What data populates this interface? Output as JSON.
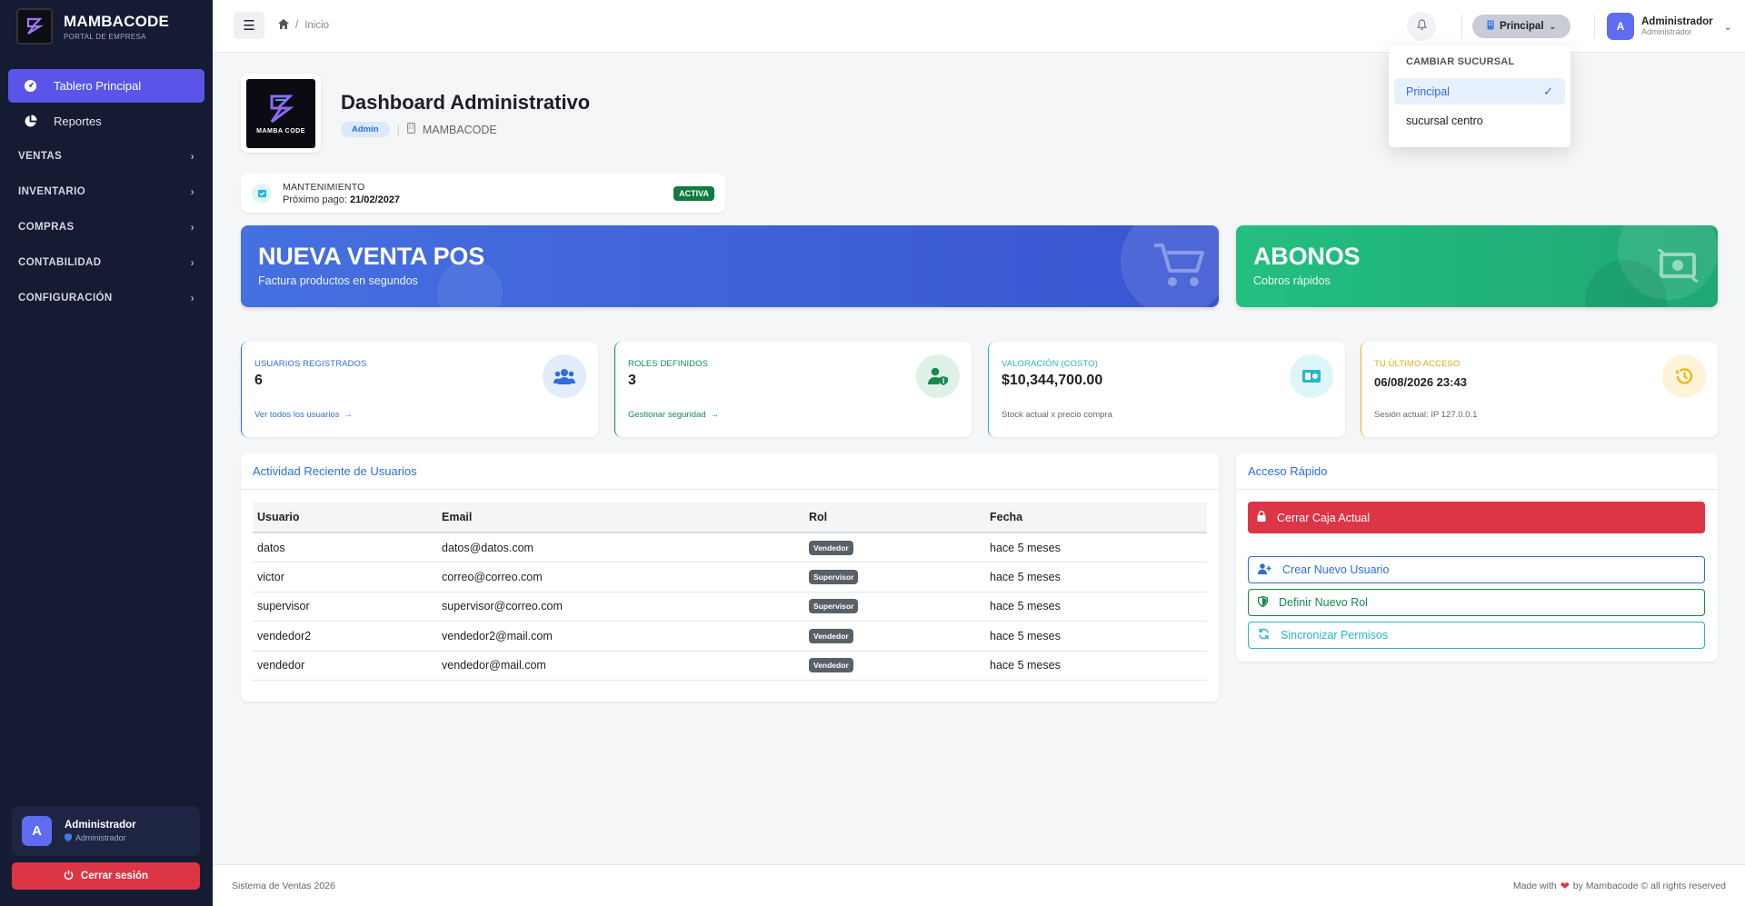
{
  "colors": {
    "sidebar_bg": "#141b33",
    "accent": "#5a55e8",
    "danger": "#dc3546",
    "success": "#0f7b3f",
    "link": "#2f6fd8",
    "promo_pos": "#4166dc",
    "promo_abonos": "#20b77a"
  },
  "sidebar": {
    "brand_name": "MAMBACODE",
    "brand_sub": "PORTAL DE EMPRESA",
    "items": [
      {
        "label": "Tablero Principal",
        "icon": "dashboard-icon"
      },
      {
        "label": "Reportes",
        "icon": "pie-chart-icon"
      }
    ],
    "groups": [
      "VENTAS",
      "INVENTARIO",
      "COMPRAS",
      "CONTABILIDAD",
      "CONFIGURACIÓN"
    ],
    "user": {
      "avatar": "A",
      "name": "Administrador",
      "role": "Administrador"
    },
    "logout_label": "Cerrar sesión"
  },
  "topbar": {
    "breadcrumb": {
      "separator": "/",
      "current": "Inicio"
    },
    "branch_label": "Principal",
    "user": {
      "avatar": "A",
      "name": "Administrador",
      "role": "Administrador"
    }
  },
  "branch_dropdown": {
    "title": "CAMBIAR SUCURSAL",
    "options": [
      {
        "label": "Principal",
        "selected": true
      },
      {
        "label": "sucursal centro",
        "selected": false
      }
    ]
  },
  "header": {
    "logo_text": "MAMBA CODE",
    "title": "Dashboard Administrativo",
    "role_badge": "Admin",
    "company": "MAMBACODE"
  },
  "maintenance": {
    "label": "MANTENIMIENTO",
    "next_payment_label": "Próximo pago:",
    "next_payment_date": "21/02/2027",
    "status": "ACTIVA"
  },
  "promos": [
    {
      "title": "NUEVA VENTA POS",
      "subtitle": "Factura productos en segundos",
      "icon": "cart-icon"
    },
    {
      "title": "ABONOS",
      "subtitle": "Cobros rápidos",
      "icon": "money-icon"
    }
  ],
  "stats": [
    {
      "label": "USUARIOS REGISTRADOS",
      "value": "6",
      "foot": "Ver todos los usuarios",
      "color": "#2f6fd8",
      "icon": "users-icon"
    },
    {
      "label": "ROLES DEFINIDOS",
      "value": "3",
      "foot": "Gestionar seguridad",
      "color": "#168a4e",
      "icon": "user-shield-icon"
    },
    {
      "label": "VALORACIÓN (COSTO)",
      "value": "$10,344,700.00",
      "foot": "Stock actual x precio compra",
      "color": "#27b6cf",
      "icon": "cash-register-icon"
    },
    {
      "label": "TU ÚLTIMO ACCESO",
      "value": "06/08/2026 23:43",
      "foot": "Sesión actual: IP 127.0.0.1",
      "color": "#f0b81c",
      "icon": "history-icon"
    }
  ],
  "activity": {
    "title": "Actividad Reciente de Usuarios",
    "columns": [
      "Usuario",
      "Email",
      "Rol",
      "Fecha"
    ],
    "rows": [
      {
        "user": "datos",
        "email": "datos@datos.com",
        "role": "Vendedor",
        "date": "hace 5 meses"
      },
      {
        "user": "victor",
        "email": "correo@correo.com",
        "role": "Supervisor",
        "date": "hace 5 meses"
      },
      {
        "user": "supervisor",
        "email": "supervisor@correo.com",
        "role": "Supervisor",
        "date": "hace 5 meses"
      },
      {
        "user": "vendedor2",
        "email": "vendedor2@mail.com",
        "role": "Vendedor",
        "date": "hace 5 meses"
      },
      {
        "user": "vendedor",
        "email": "vendedor@mail.com",
        "role": "Vendedor",
        "date": "hace 5 meses"
      }
    ]
  },
  "quick_access": {
    "title": "Acceso Rápido",
    "close_cash": "Cerrar Caja Actual",
    "new_user": "Crear Nuevo Usuario",
    "new_role": "Definir Nuevo Rol",
    "sync": "Sincronizar Permisos"
  },
  "footer": {
    "left": "Sistema de Ventas 2026",
    "made_with": "Made with",
    "by": "by Mambacode © all rights reserved"
  }
}
